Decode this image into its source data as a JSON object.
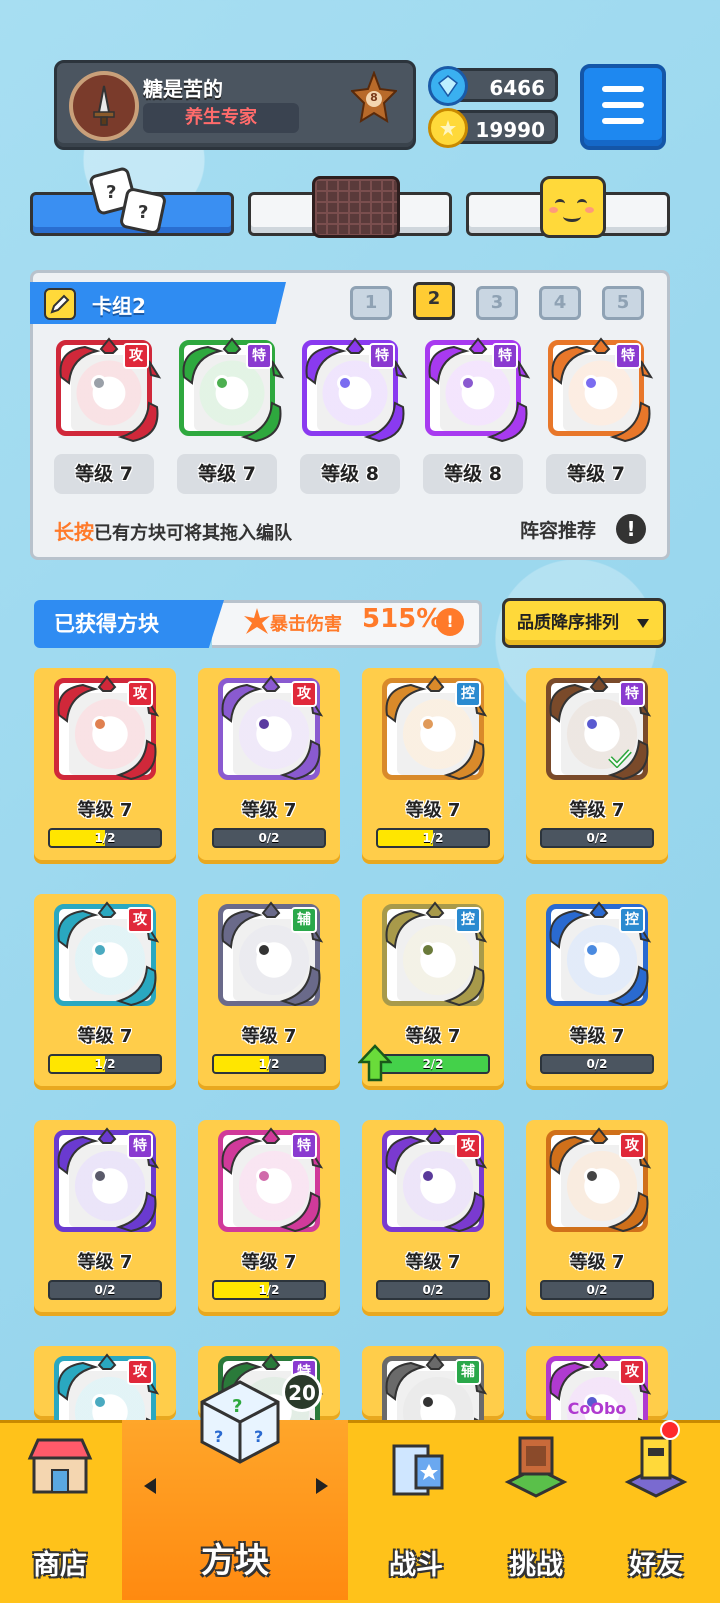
{
  "profile": {
    "name": "糖是苦的",
    "title": "养生专家",
    "rank": "8"
  },
  "currency": {
    "gems": "6466",
    "coins": "19990"
  },
  "deck": {
    "name": "卡组2",
    "numbers": [
      "1",
      "2",
      "3",
      "4",
      "5"
    ],
    "active_index": 1,
    "cards": [
      {
        "tag": "攻",
        "level": "等级 7",
        "color": "#d0283a",
        "dot": "#9aa0a8"
      },
      {
        "tag": "特",
        "level": "等级 7",
        "color": "#2ea83e",
        "dot": "#4caf50"
      },
      {
        "tag": "特",
        "level": "等级 8",
        "color": "#8a3af0",
        "dot": "#7a6cf0"
      },
      {
        "tag": "特",
        "level": "等级 8",
        "color": "#a83af0",
        "dot": "#8a5ad0"
      },
      {
        "tag": "特",
        "level": "等级 7",
        "color": "#e8772a",
        "dot": "#7a6cf0"
      }
    ],
    "hint_strong": "长按",
    "hint_text": "已有方块可将其拖入编队",
    "recommend": "阵容推荐"
  },
  "owned": {
    "label": "已获得方块",
    "crit_label": "暴击伤害",
    "crit_value": "515%",
    "sort": "品质降序排列",
    "cells": [
      {
        "tag": "攻",
        "level": "等级 7",
        "progress": "1/2",
        "ratio": 0.5,
        "color": "#d0283a",
        "dot": "#e08050"
      },
      {
        "tag": "攻",
        "level": "等级 7",
        "progress": "0/2",
        "ratio": 0,
        "color": "#8a5ad0",
        "dot": "#5a3aa0"
      },
      {
        "tag": "控",
        "level": "等级 7",
        "progress": "1/2",
        "ratio": 0.5,
        "color": "#d98a2a",
        "dot": "#e09a5a"
      },
      {
        "tag": "特",
        "level": "等级 7",
        "progress": "0/2",
        "ratio": 0,
        "color": "#7a4a2a",
        "dot": "#5a5ad0",
        "check": true
      },
      {
        "tag": "攻",
        "level": "等级 7",
        "progress": "1/2",
        "ratio": 0.5,
        "color": "#2aa8c0",
        "dot": "#4aaac0"
      },
      {
        "tag": "辅",
        "level": "等级 7",
        "progress": "1/2",
        "ratio": 0.5,
        "color": "#6a6a8a",
        "dot": "#333"
      },
      {
        "tag": "控",
        "level": "等级 7",
        "progress": "2/2",
        "ratio": 1,
        "color": "#a89a4a",
        "dot": "#6a7a3a",
        "upgrade": true
      },
      {
        "tag": "控",
        "level": "等级 7",
        "progress": "0/2",
        "ratio": 0,
        "color": "#2a6ad0",
        "dot": "#4a8ae0"
      },
      {
        "tag": "特",
        "level": "等级 7",
        "progress": "0/2",
        "ratio": 0,
        "color": "#6a3ad0",
        "dot": "#5a5a6a"
      },
      {
        "tag": "特",
        "level": "等级 7",
        "progress": "1/2",
        "ratio": 0.5,
        "color": "#d03a9a",
        "dot": "#d06aaa"
      },
      {
        "tag": "攻",
        "level": "等级 7",
        "progress": "0/2",
        "ratio": 0,
        "color": "#7a3ad0",
        "dot": "#5a3a9a"
      },
      {
        "tag": "攻",
        "level": "等级 7",
        "progress": "0/2",
        "ratio": 0,
        "color": "#d0701a",
        "dot": "#444"
      },
      {
        "tag": "攻",
        "color": "#2aa8c0",
        "dot": "#4aaac0"
      },
      {
        "tag": "特",
        "color": "#2a7a3a",
        "dot": "#444"
      },
      {
        "tag": "辅",
        "color": "#6a6a6a",
        "dot": "#333"
      },
      {
        "tag": "攻",
        "color": "#b03ad0",
        "dot": "#5a5ad0",
        "text": "CoObo"
      }
    ]
  },
  "tag_colors": {
    "攻": "#e0283a",
    "特": "#8a3ad0",
    "控": "#2a8ad0",
    "辅": "#2aa84a"
  },
  "nav": {
    "shop": "商店",
    "blocks": "方块",
    "battle": "战斗",
    "challenge": "挑战",
    "friends": "好友",
    "blocks_badge": "20"
  }
}
